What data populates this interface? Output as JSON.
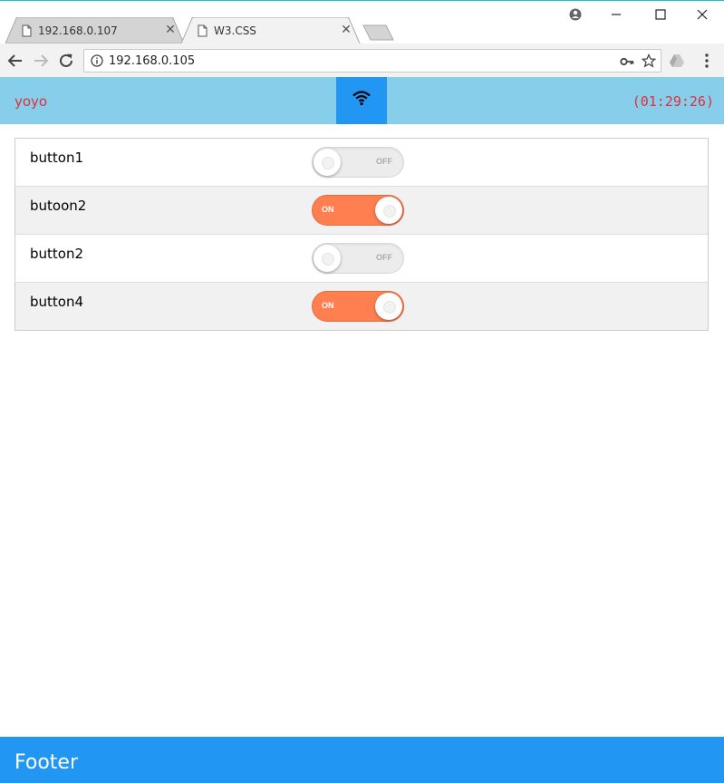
{
  "browser": {
    "tabs": [
      {
        "title": "192.168.0.107",
        "active": false
      },
      {
        "title": "W3.CSS",
        "active": true
      }
    ],
    "url": "192.168.0.105",
    "icons": {
      "page": "page-icon",
      "close": "close-icon",
      "profile": "profile-icon",
      "minimize": "minimize-icon",
      "maximize": "maximize-icon",
      "close_window": "close-icon",
      "back": "back-arrow-icon",
      "forward": "forward-arrow-icon",
      "reload": "reload-icon",
      "info": "info-icon",
      "key": "key-icon",
      "star": "star-icon",
      "drive": "drive-icon",
      "menu": "menu-icon"
    }
  },
  "header": {
    "brand": "yoyo",
    "clock": "(01:29:26)",
    "wifi_icon": "wifi-icon",
    "colors": {
      "bar": "#87ceeb",
      "wifi_button": "#2196f3",
      "text": "#e0303a"
    }
  },
  "rows": [
    {
      "label": "button1",
      "state": "OFF",
      "on": false
    },
    {
      "label": "butoon2",
      "state": "ON",
      "on": true
    },
    {
      "label": "button2",
      "state": "OFF",
      "on": false
    },
    {
      "label": "button4",
      "state": "ON",
      "on": true
    }
  ],
  "switch_colors": {
    "on": "#ff7f50",
    "off": "#ececec"
  },
  "footer": {
    "text": "Footer",
    "color": "#2196f3"
  }
}
